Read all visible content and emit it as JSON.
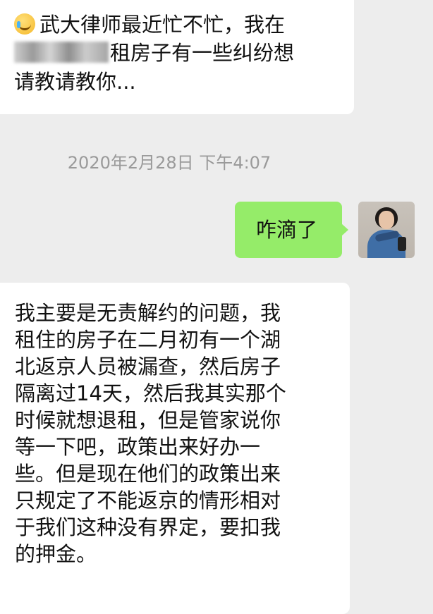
{
  "messages": [
    {
      "sender": "contact",
      "lines": [
        "武大律师最近忙不忙，我在",
        "租房子有一些纠纷想",
        "请教请教你..."
      ]
    },
    {
      "sender": "me",
      "text": "咋滴了"
    },
    {
      "sender": "contact",
      "lines": [
        "我主要是无责解约的问题，我",
        "租住的房子在二月初有一个湖",
        "北返京人员被漏查，然后房子",
        "隔离过14天，然后我其实那个",
        "时候就想退租，但是管家说你",
        "等一下吧，政策出来好办一",
        "些。但是现在他们的政策出来",
        "只规定了不能返京的情形相对",
        "于我们这种没有界定，要扣我",
        "的押金。"
      ]
    }
  ],
  "timestamp": "2020年2月28日 下午4:07",
  "icons": {
    "emoji": "facepalm-emoji-icon",
    "redaction": "blurred-text-redaction",
    "avatar": "user-avatar-photo"
  },
  "colors": {
    "background": "#ededed",
    "incoming_bubble": "#ffffff",
    "outgoing_bubble": "#95ec69",
    "timestamp_text": "#9a9a9a"
  }
}
